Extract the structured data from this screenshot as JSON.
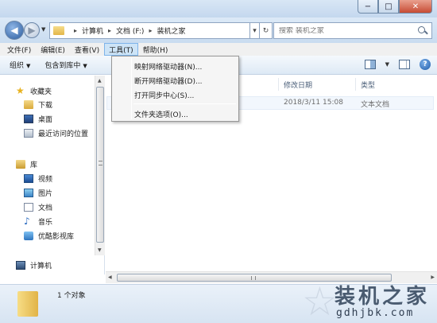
{
  "titlebar": {
    "minimize": "−",
    "maximize": "□",
    "close": "✕"
  },
  "address": {
    "segments": [
      "计算机",
      "文档 (F:)",
      "装机之家"
    ],
    "dropdown_glyph": "▾",
    "refresh_glyph": "↻",
    "search_placeholder": "搜索 装机之家"
  },
  "menubar": {
    "items": [
      "文件(F)",
      "编辑(E)",
      "查看(V)",
      "工具(T)",
      "帮助(H)"
    ],
    "active_index": 3
  },
  "toolbar": {
    "organize": "组织",
    "include_in_library": "包含到库中",
    "help": "?"
  },
  "navpane": {
    "favorites": {
      "label": "收藏夹",
      "items": [
        "下载",
        "桌面",
        "最近访问的位置"
      ]
    },
    "libraries": {
      "label": "库",
      "items": [
        "视频",
        "图片",
        "文档",
        "音乐",
        "优酷影视库"
      ]
    },
    "computer": "计算机"
  },
  "columns": {
    "modified": "修改日期",
    "type": "类型"
  },
  "file": {
    "modified": "2018/3/11 15:08",
    "type": "文本文档"
  },
  "tools_menu": {
    "items": [
      "映射网络驱动器(N)...",
      "断开网络驱动器(D)...",
      "打开同步中心(S)...",
      "文件夹选项(O)..."
    ]
  },
  "status": {
    "count": "1 个对象"
  },
  "watermark": {
    "title": "装机之家",
    "url": "gdhjbk.com"
  },
  "colors": {
    "accent": "#7eb4ea",
    "menu_active_bg": "#cde4f7"
  }
}
